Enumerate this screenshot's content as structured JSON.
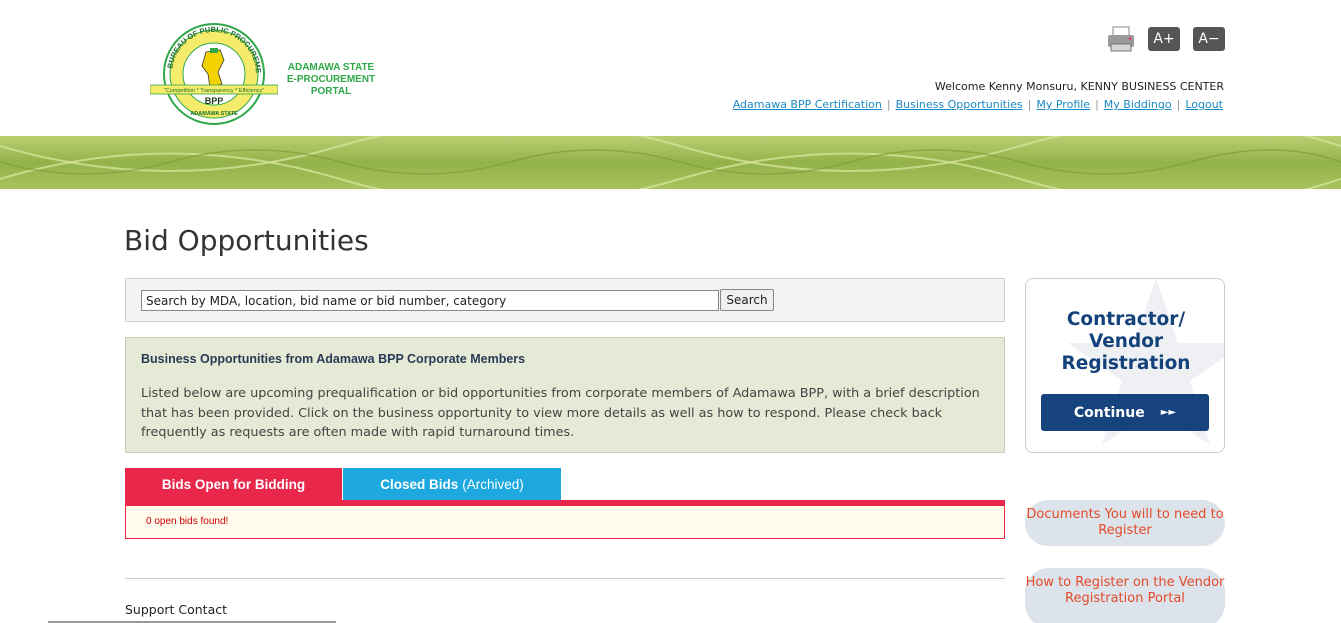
{
  "header": {
    "logo_ring_text": "BUREAU OF PUBLIC PROCUREMENT",
    "logo_motto": "\"Competition * Transparency * Efficiency\"",
    "logo_acronym": "BPP",
    "logo_bottom_text": "ADAMAWA STATE",
    "portal_line1": "ADAMAWA STATE",
    "portal_line2": "E-PROCUREMENT PORTAL",
    "font_increase": "A+",
    "font_decrease": "A−",
    "welcome_prefix": "Welcome",
    "welcome_user": "Kenny Monsuru, KENNY BUSINESS CENTER",
    "links": [
      "Adamawa BPP Certification",
      "Business Opportunities",
      "My Profile",
      "My Biddingo",
      "Logout"
    ],
    "separator": "|"
  },
  "main": {
    "title": "Bid Opportunities",
    "search": {
      "value": "Search by MDA, location, bid name or bid number, category",
      "button": "Search"
    },
    "info": {
      "title": "Business Opportunities from Adamawa BPP Corporate Members",
      "text": "Listed below are upcoming prequalification or bid opportunities from corporate members of Adamawa BPP, with a brief description that has been provided. Click on the business opportunity to view more details as well as how to respond. Please check back frequently as requests are often made with rapid turnaround times."
    },
    "tabs": {
      "open": "Bids Open for Bidding",
      "closed": "Closed Bids",
      "closed_sub": "(Archived)"
    },
    "results_text": "0 open bids found!",
    "support_heading": "Support Contact"
  },
  "sidebar": {
    "reg_title_line1": "Contractor/",
    "reg_title_line2": "Vendor",
    "reg_title_line3": "Registration",
    "continue_label": "Continue",
    "continue_arrow": "►►",
    "docs_link": "Documents You will to need to Register",
    "how_link": "How to Register on the Vendor Registration Portal"
  },
  "colors": {
    "banner_green": "#9fbb52",
    "tab_open": "#e8274a",
    "tab_closed": "#1ea8e0",
    "navy": "#16437e",
    "link_blue": "#1a8ac7",
    "side_link_text": "#e24b2a"
  },
  "icons": [
    "print-icon",
    "star-watermark-icon",
    "double-arrow-icon"
  ]
}
